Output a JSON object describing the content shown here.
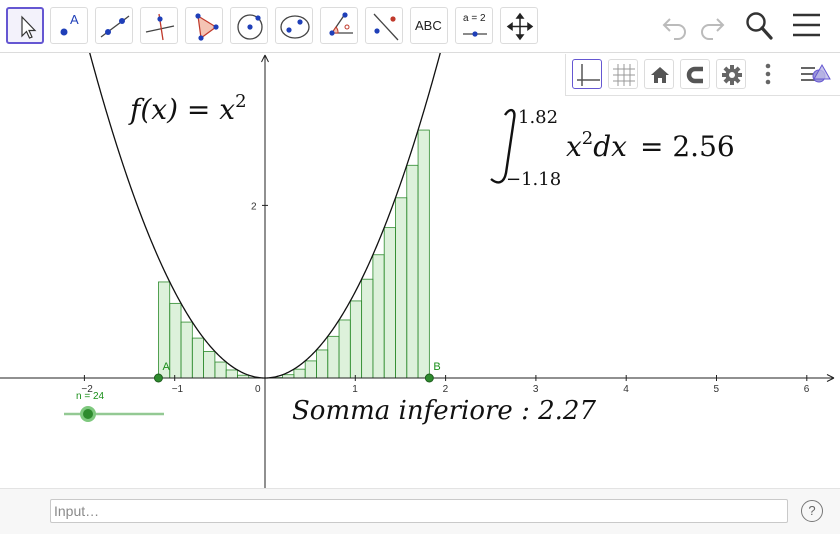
{
  "toolbar": {
    "tools": [
      {
        "name": "move-tool",
        "icon": "pointer-icon"
      },
      {
        "name": "point-tool",
        "icon": "point-icon",
        "label": "A"
      },
      {
        "name": "line-tool",
        "icon": "line-icon"
      },
      {
        "name": "perpendicular-tool",
        "icon": "perpendicular-icon"
      },
      {
        "name": "polygon-tool",
        "icon": "polygon-icon"
      },
      {
        "name": "circle-tool",
        "icon": "circle-icon"
      },
      {
        "name": "conic-tool",
        "icon": "ellipse-icon"
      },
      {
        "name": "angle-tool",
        "icon": "angle-icon"
      },
      {
        "name": "reflect-tool",
        "icon": "reflect-icon"
      },
      {
        "name": "text-tool",
        "icon": "text-icon",
        "label": "ABC"
      },
      {
        "name": "slider-tool",
        "icon": "slider-icon",
        "label": "a = 2"
      },
      {
        "name": "move-graphics-tool",
        "icon": "move-view-icon"
      }
    ],
    "right_icons": [
      "undo-icon",
      "redo-icon",
      "search-icon",
      "menu-icon"
    ]
  },
  "stylebar": {
    "buttons": [
      "axes-icon",
      "grid-icon",
      "home-icon",
      "magnet-icon",
      "gear-icon",
      "more-icon",
      "toggle-style-bar-icon"
    ]
  },
  "graph": {
    "function_label": {
      "lhs": "f(x) = x",
      "exp": "2"
    },
    "integral": {
      "upper": "1.82",
      "lower": "−1.18",
      "integrand": "x",
      "exp": "2",
      "dx": "dx",
      "result": "= 2.56"
    },
    "sum_label": "Somma inferiore : 2.27",
    "point_a": "A",
    "point_b": "B",
    "slider_label": "n = 24",
    "x_ticks": [
      "−2",
      "−1",
      "0",
      "1",
      "2",
      "3",
      "4",
      "5",
      "6"
    ],
    "y_ticks": [
      "2"
    ]
  },
  "chart_data": {
    "type": "bar",
    "title": "",
    "function": "f(x) = x^2",
    "a": -1.18,
    "b": 1.82,
    "n": 24,
    "integral": 2.56,
    "lower_sum": 2.27,
    "xlim": [
      -2.9,
      6.3
    ],
    "ylim": [
      -0.7,
      3.6
    ],
    "x_ticks": [
      -2,
      -1,
      0,
      1,
      2,
      3,
      4,
      5,
      6
    ],
    "y_ticks": [
      2
    ]
  },
  "input": {
    "placeholder": "Input…"
  },
  "help": {
    "label": "?"
  }
}
